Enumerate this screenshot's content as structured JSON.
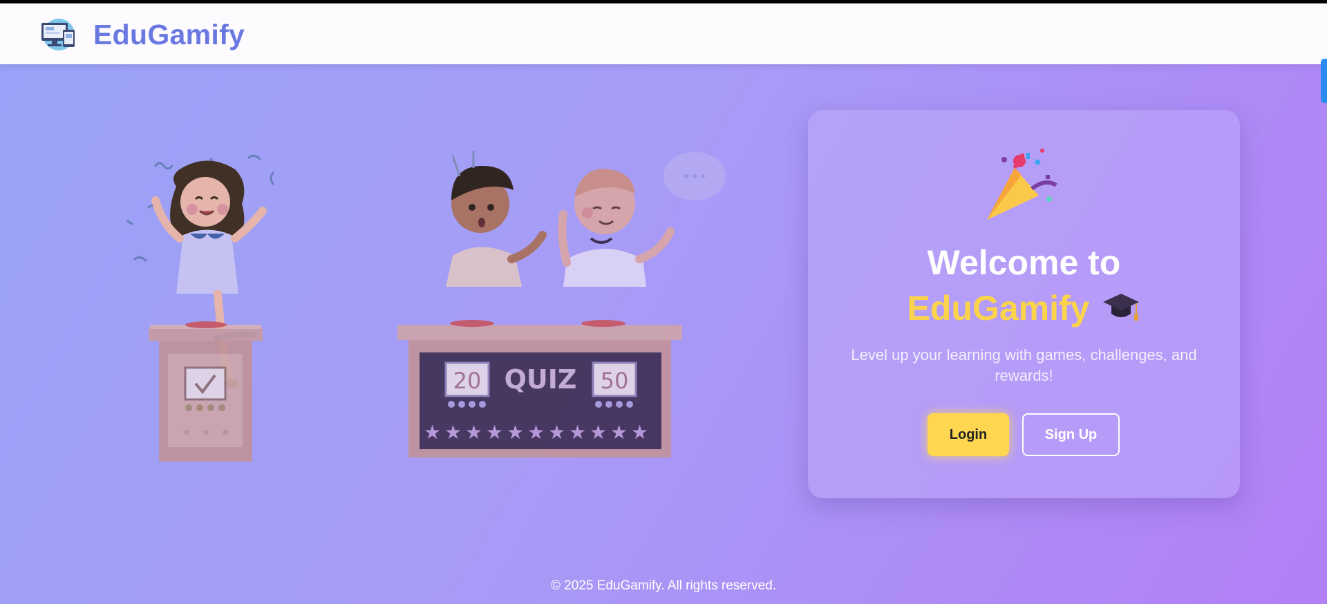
{
  "header": {
    "brand": "EduGamify",
    "logo_icon": "computer-devices-icon"
  },
  "hero": {
    "illustration": "kids-quiz-show-illustration",
    "quiz_board": {
      "left_score": "20",
      "label": "QUIZ",
      "right_score": "50"
    }
  },
  "welcome_card": {
    "icon": "party-popper-icon",
    "title_line1": "Welcome to",
    "title_brand": "EduGamify",
    "title_icon": "graduation-cap-icon",
    "tagline": "Level up your learning with games, challenges, and rewards!",
    "login_label": "Login",
    "signup_label": "Sign Up"
  },
  "footer": {
    "text": "© 2025 EduGamify. All rights reserved."
  },
  "colors": {
    "brand": "#6a78e2",
    "accent_yellow": "#fed64f",
    "background_start": "#98a3f6",
    "background_end": "#b27ff5"
  }
}
